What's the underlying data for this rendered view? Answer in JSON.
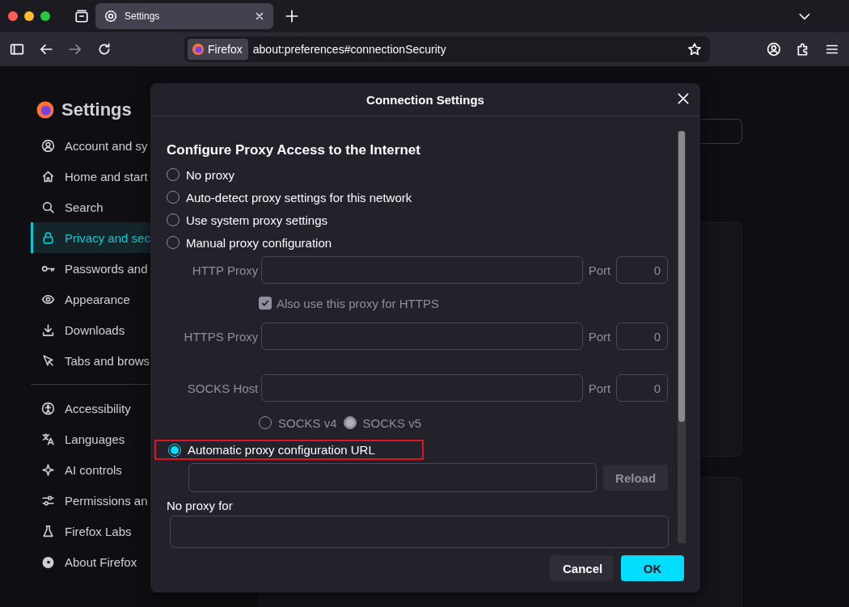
{
  "browser": {
    "tabs": [
      {
        "title": "Settings",
        "selected": true
      }
    ],
    "identity": "Firefox",
    "url": "about:preferences#connectionSecurity"
  },
  "sidebar": {
    "title": "Settings",
    "items": [
      {
        "kind": "account",
        "label": "Account and sy",
        "selected": false
      },
      {
        "kind": "home",
        "label": "Home and start",
        "selected": false
      },
      {
        "kind": "search",
        "label": "Search",
        "selected": false
      },
      {
        "kind": "lock",
        "label": "Privacy and sec",
        "selected": true
      },
      {
        "kind": "key",
        "label": "Passwords and",
        "selected": false
      },
      {
        "kind": "eye",
        "label": "Appearance",
        "selected": false
      },
      {
        "kind": "download",
        "label": "Downloads",
        "selected": false
      },
      {
        "kind": "pointer",
        "label": "Tabs and brows",
        "selected": false
      }
    ],
    "more_items": [
      {
        "kind": "accessibility",
        "label": "Accessibility",
        "selected": false
      },
      {
        "kind": "language",
        "label": "Languages",
        "selected": false
      },
      {
        "kind": "sparkle",
        "label": "AI controls",
        "selected": false
      },
      {
        "kind": "sliders",
        "label": "Permissions an",
        "selected": false
      },
      {
        "kind": "flask",
        "label": "Firefox Labs",
        "selected": false
      },
      {
        "kind": "firefox",
        "label": "About Firefox",
        "selected": false
      }
    ]
  },
  "dialog": {
    "title": "Connection Settings",
    "heading": "Configure Proxy Access to the Internet",
    "options": [
      {
        "label": "No proxy",
        "selected": false
      },
      {
        "label": "Auto-detect proxy settings for this network",
        "selected": false
      },
      {
        "label": "Use system proxy settings",
        "selected": false
      },
      {
        "label": "Manual proxy configuration",
        "selected": false
      }
    ],
    "manual": {
      "disabled": true,
      "proxies": [
        {
          "kind": "host",
          "label": "HTTP Proxy",
          "port_label": "Port",
          "port": "0"
        },
        {
          "kind": "checkbox",
          "label": "Also use this proxy for HTTPS",
          "checked": true
        },
        {
          "kind": "host",
          "label": "HTTPS Proxy",
          "port_label": "Port",
          "port": "0"
        },
        {
          "kind": "host",
          "label": "SOCKS Host",
          "port_label": "Port",
          "port": "0"
        }
      ],
      "socks_versions": [
        {
          "label": "SOCKS v4",
          "selected": false
        },
        {
          "label": "SOCKS v5",
          "selected": true
        }
      ]
    },
    "auto": {
      "label": "Automatic proxy configuration URL",
      "selected": true,
      "highlighted": true,
      "reload": {
        "label": "Reload",
        "disabled": true
      }
    },
    "no_proxy_label": "No proxy for",
    "buttons": [
      {
        "kind": "secondary",
        "label": "Cancel"
      },
      {
        "kind": "primary",
        "label": "OK"
      }
    ]
  }
}
